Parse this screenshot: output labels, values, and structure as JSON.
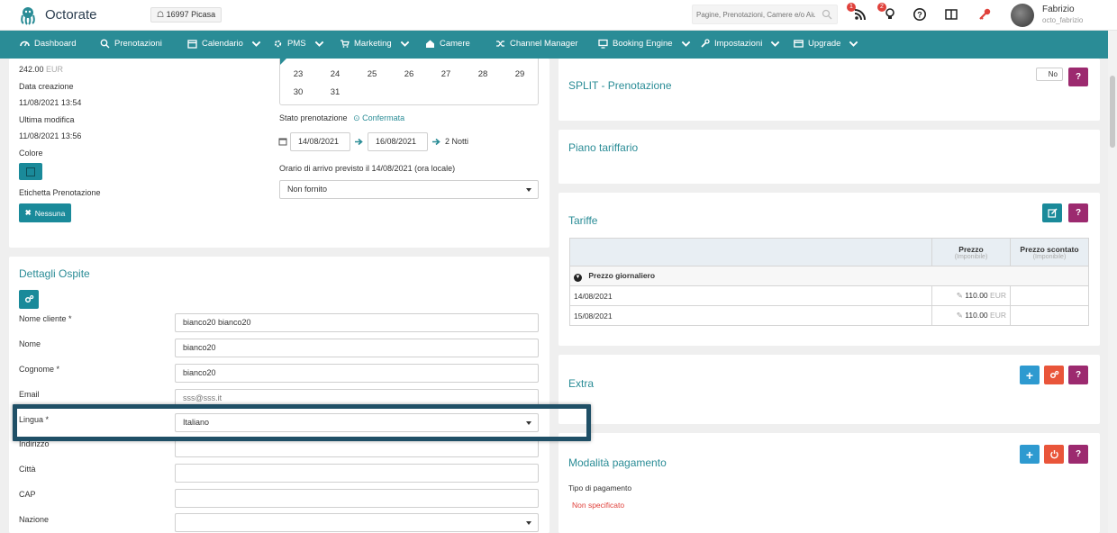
{
  "app": {
    "name": "Octorate",
    "property_code": "16997",
    "property_name": "Picasa"
  },
  "search": {
    "placeholder": "Pagine, Prenotazioni, Camere e/o Aiuto"
  },
  "notifications": {
    "feed_badge": "1",
    "bulb_badge": "2"
  },
  "user": {
    "name": "Fabrizio",
    "login": "octo_fabrizio"
  },
  "nav": [
    {
      "label": "Dashboard",
      "icon": "dashboard-icon"
    },
    {
      "label": "Prenotazioni",
      "icon": "search-icon"
    },
    {
      "label": "Calendario",
      "icon": "calendar-icon"
    },
    {
      "label": "PMS",
      "icon": "gear-icon"
    },
    {
      "label": "Marketing",
      "icon": "cart-icon"
    },
    {
      "label": "Camere",
      "icon": "home-icon"
    },
    {
      "label": "Channel Manager",
      "icon": "shuffle-icon"
    },
    {
      "label": "Booking Engine",
      "icon": "monitor-icon"
    },
    {
      "label": "Impostazioni",
      "icon": "wrench-icon"
    },
    {
      "label": "Upgrade",
      "icon": "card-icon"
    }
  ],
  "booking": {
    "amount": "242.00",
    "currency": "EUR",
    "created_label": "Data creazione",
    "created": "11/08/2021 13:54",
    "modified_label": "Ultima modifica",
    "modified": "11/08/2021 13:56",
    "color_label": "Colore",
    "tag_label": "Etichetta Prenotazione",
    "tag_button": "Nessuna",
    "color_hex": "#1a8a9a"
  },
  "calendar": {
    "row1": [
      "23",
      "24",
      "25",
      "26",
      "27",
      "28",
      "29"
    ],
    "row2": [
      "30",
      "31"
    ]
  },
  "status": {
    "label": "Stato prenotazione",
    "value": "Confermata",
    "checkin": "14/08/2021",
    "checkout": "16/08/2021",
    "nights": "2 Notti",
    "arrival_label": "Orario di arrivo previsto il 14/08/2021 (ora locale)",
    "arrival_value": "Non fornito"
  },
  "guest": {
    "title": "Dettagli Ospite",
    "fields": [
      {
        "label": "Nome cliente *",
        "value": "bianco20 bianco20"
      },
      {
        "label": "Nome",
        "value": "bianco20"
      },
      {
        "label": "Cognome *",
        "value": "bianco20"
      },
      {
        "label": "Email",
        "value": "sss@sss.it"
      },
      {
        "label": "Lingua *",
        "value": "Italiano"
      },
      {
        "label": "Indirizzo",
        "value": ""
      },
      {
        "label": "Città",
        "value": ""
      },
      {
        "label": "CAP",
        "value": ""
      },
      {
        "label": "Nazione",
        "value": ""
      }
    ]
  },
  "split": {
    "title": "SPLIT - Prenotazione",
    "toggle": "No"
  },
  "rate_plan": {
    "title": "Piano tariffario"
  },
  "tariffe": {
    "title": "Tariffe",
    "col_price": "Prezzo",
    "col_price_sub": "(Imponibile)",
    "col_discount": "Prezzo scontato",
    "col_discount_sub": "(Imponibile)",
    "group": "Prezzo giornaliero",
    "rows": [
      {
        "date": "14/08/2021",
        "price": "110.00",
        "currency": "EUR"
      },
      {
        "date": "15/08/2021",
        "price": "110.00",
        "currency": "EUR"
      }
    ]
  },
  "extra": {
    "title": "Extra"
  },
  "payment": {
    "title": "Modalità pagamento",
    "type_label": "Tipo di pagamento",
    "type_value": "Non specificato"
  },
  "help": "?"
}
